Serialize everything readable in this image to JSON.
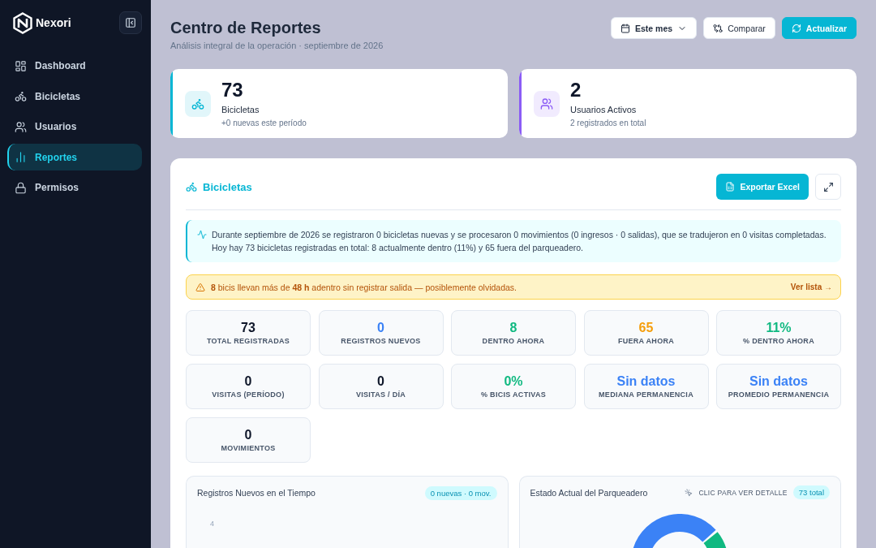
{
  "sidebar": {
    "brand": "Nexori",
    "items": [
      {
        "label": "Dashboard",
        "selected": false
      },
      {
        "label": "Bicicletas",
        "selected": false
      },
      {
        "label": "Usuarios",
        "selected": false
      },
      {
        "label": "Reportes",
        "selected": true
      },
      {
        "label": "Permisos",
        "selected": false
      }
    ]
  },
  "header": {
    "title": "Centro de Reportes",
    "subtitle": "Análisis integral de la operación · septiembre de 2026",
    "buttons": [
      {
        "label": "Este mes",
        "kind": "dropdown"
      },
      {
        "label": "Comparar",
        "kind": "secondary"
      },
      {
        "label": "Actualizar",
        "kind": "primary"
      }
    ]
  },
  "summary_cards": [
    {
      "value": "73",
      "label": "Bicicletas",
      "note": "+0 nuevas este período",
      "color": "#06b6d4"
    },
    {
      "value": "2",
      "label": "Usuarios Activos",
      "note": "2 registrados en total",
      "color": "#8b5cf6"
    }
  ],
  "panel": {
    "title": "Bicicletas",
    "export_button": "Exportar Excel",
    "summary": "Durante septiembre de 2026 se registraron 0 bicicletas nuevas y se procesaron 0 movimientos (0 ingresos · 0 salidas), que se tradujeron en 0 visitas completadas. Hoy hay 73 bicicletas registradas en total: 8 actualmente dentro (11%) y 65 fuera del parqueadero.",
    "alert": {
      "text": "**8** bicis llevan más de **48 h** adentro sin registrar salida — posiblemente olvidadas.",
      "link": "Ver lista →"
    },
    "metrics": [
      {
        "value": "73",
        "label": "TOTAL REGISTRADAS",
        "color": "#0f172a"
      },
      {
        "value": "0",
        "label": "REGISTROS NUEVOS",
        "color": "#3b82f6"
      },
      {
        "value": "8",
        "label": "DENTRO AHORA",
        "color": "#10b981"
      },
      {
        "value": "65",
        "label": "FUERA AHORA",
        "color": "#f59e0b"
      },
      {
        "value": "11%",
        "label": "% DENTRO AHORA",
        "color": "#10b981"
      },
      {
        "value": "0",
        "label": "VISITAS (PERÍODO)",
        "color": "#0f172a"
      },
      {
        "value": "0",
        "label": "VISITAS / DÍA",
        "color": "#0f172a"
      },
      {
        "value": "0%",
        "label": "% BICIS ACTIVAS",
        "color": "#10b981"
      },
      {
        "value": "Sin datos",
        "label": "MEDIANA PERMANENCIA",
        "color": "#3b82f6"
      },
      {
        "value": "Sin datos",
        "label": "PROMEDIO PERMANENCIA",
        "color": "#3b82f6"
      },
      {
        "value": "0",
        "label": "MOVIMIENTOS",
        "color": "#0f172a"
      }
    ],
    "charts": [
      {
        "kind": "trend",
        "title": "Registros Nuevos en el Tiempo",
        "badge": "0 nuevas · 0 mov.",
        "y_tick_labels": [
          "4"
        ]
      },
      {
        "kind": "donut",
        "title": "Estado Actual del Parqueadero",
        "hint": "CLIC PARA VER DETALLE",
        "badge": "73 total"
      }
    ]
  }
}
